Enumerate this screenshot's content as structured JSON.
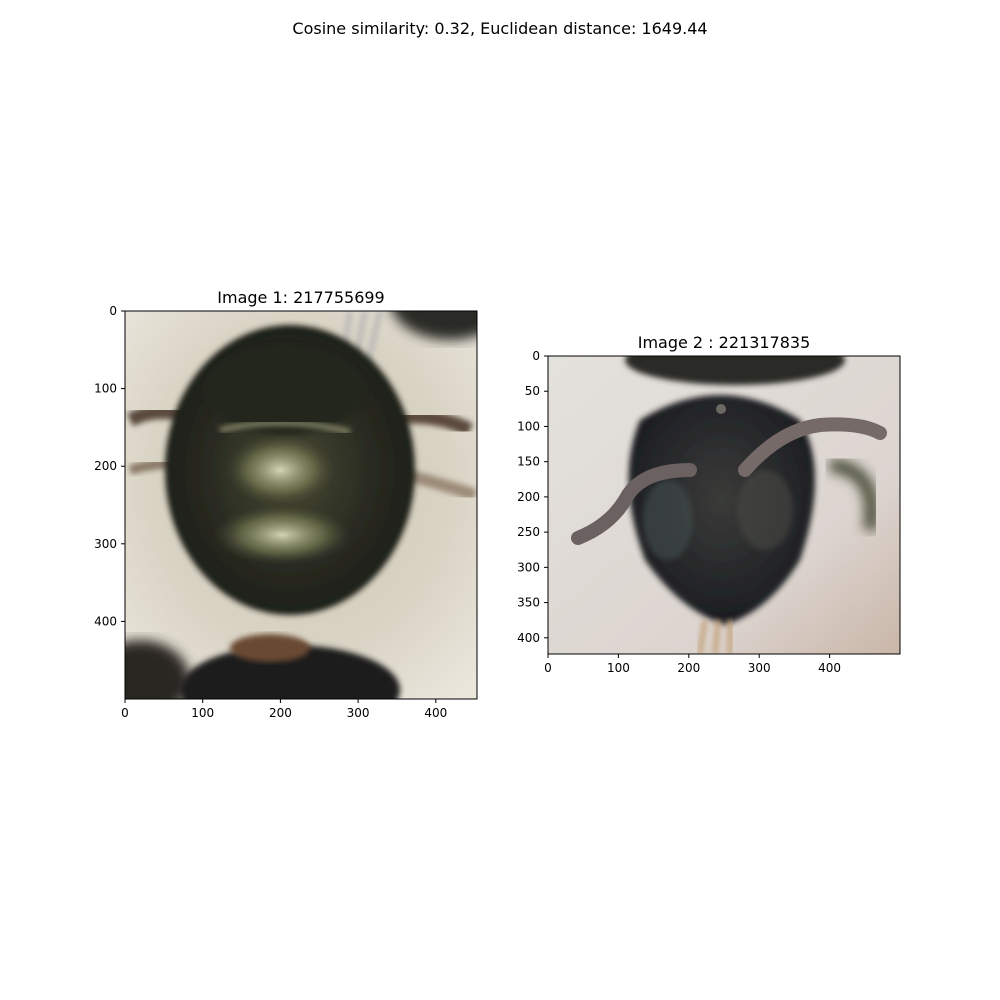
{
  "suptitle": "Cosine similarity: 0.32, Euclidean distance: 1649.44",
  "chart_data": [
    {
      "type": "image",
      "title": "Image 1: 217755699",
      "image_width": 453,
      "image_height": 500,
      "xlim": [
        0,
        453
      ],
      "ylim": [
        500,
        0
      ],
      "xticks": [
        0,
        100,
        200,
        300,
        400
      ],
      "yticks": [
        0,
        100,
        200,
        300,
        400
      ],
      "content": "close-up micrograph of a dark metallic bee thorax on a pale background",
      "colors": {
        "background": "#d9d2c3",
        "subject": "#2a2d22",
        "highlight": "#b9bd8a"
      }
    },
    {
      "type": "image",
      "title": "Image 2 : 221317835",
      "image_width": 500,
      "image_height": 423,
      "xlim": [
        0,
        500
      ],
      "ylim": [
        423,
        0
      ],
      "xticks": [
        0,
        100,
        200,
        300,
        400
      ],
      "yticks": [
        0,
        50,
        100,
        150,
        200,
        250,
        300,
        350,
        400
      ],
      "content": "frontal micrograph of a dark bee head with antennae on a light background",
      "colors": {
        "background": "#ddd6d2",
        "subject": "#26282a",
        "antenna": "#6e6462"
      }
    }
  ]
}
